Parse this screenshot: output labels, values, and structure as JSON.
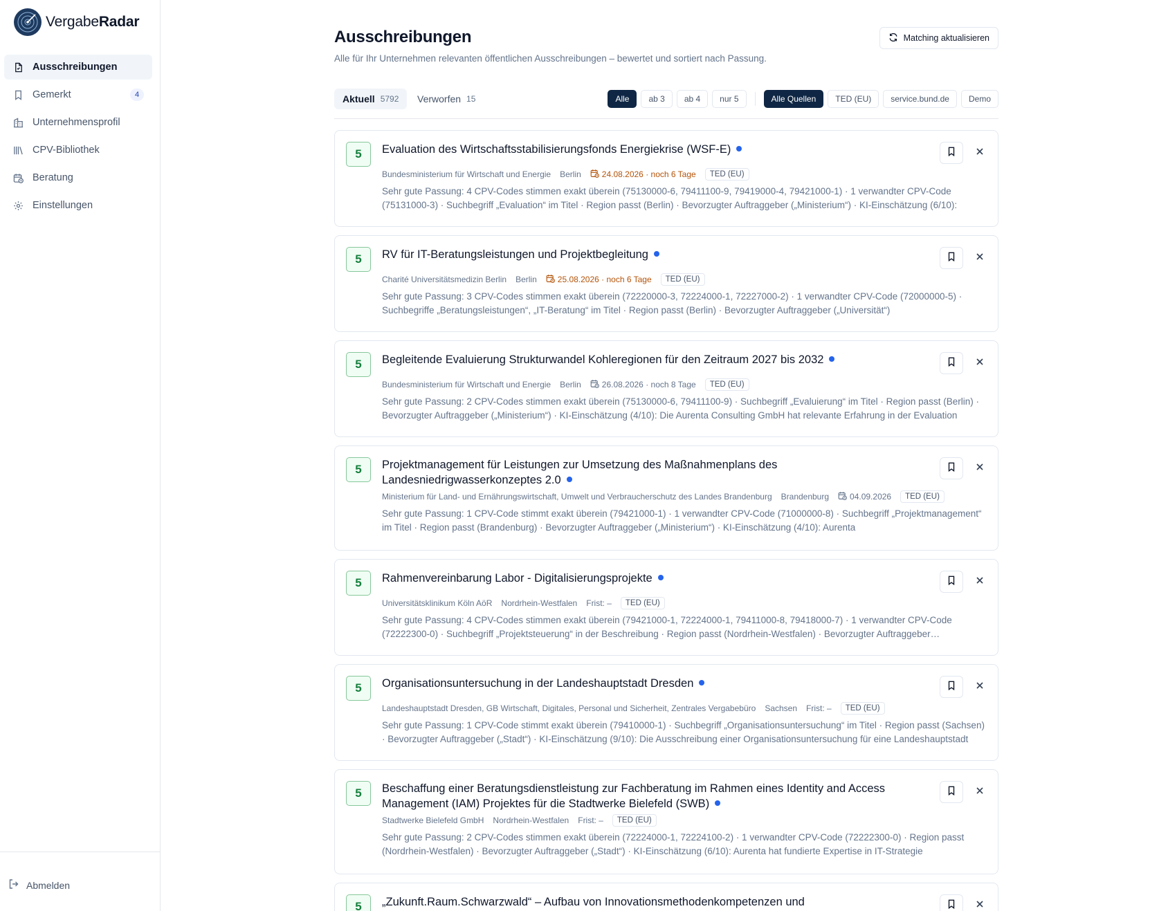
{
  "app": {
    "name_part1": "Vergabe",
    "name_part2": "Radar"
  },
  "sidebar": {
    "items": [
      {
        "label": "Ausschreibungen",
        "icon": "document-icon",
        "active": true
      },
      {
        "label": "Gemerkt",
        "icon": "bookmark-icon",
        "badge": "4"
      },
      {
        "label": "Unternehmensprofil",
        "icon": "building-icon"
      },
      {
        "label": "CPV-Bibliothek",
        "icon": "library-icon"
      },
      {
        "label": "Beratung",
        "icon": "calendar-clock-icon"
      },
      {
        "label": "Einstellungen",
        "icon": "gear-icon"
      }
    ],
    "logout": "Abmelden"
  },
  "header": {
    "title": "Ausschreibungen",
    "subtitle": "Alle für Ihr Unternehmen relevanten öffentlichen Ausschreibungen – bewertet und sortiert nach Passung.",
    "refresh_label": "Matching aktualisieren"
  },
  "tabs": [
    {
      "label": "Aktuell",
      "count": "5792"
    },
    {
      "label": "Verworfen",
      "count": "15"
    }
  ],
  "score_filters": [
    "Alle",
    "ab 3",
    "ab 4",
    "nur 5"
  ],
  "source_filters": [
    "Alle Quellen",
    "TED (EU)",
    "service.bund.de",
    "Demo"
  ],
  "colors": {
    "accent": "#0f2744",
    "score_green": "#15803d",
    "unread_dot": "#2563eb",
    "deadline_warn": "#b45309"
  },
  "tenders": [
    {
      "score": "5",
      "title": "Evaluation des Wirtschaftsstabilisierungsfonds Energiekrise (WSF-E)",
      "authority": "Bundesministerium für Wirtschaft und Energie",
      "region": "Berlin",
      "deadline": "24.08.2026 · noch 6 Tage",
      "deadline_warn": true,
      "source": "TED (EU)",
      "description": "Sehr gute Passung: 4 CPV-Codes stimmen exakt überein (75130000-6, 79411100-9, 79419000-4, 79421000-1) · 1 verwandter CPV-Code (75131000-3) · Suchbegriff „Evaluation“ im Titel · Region passt (Berlin) · Bevorzugter Auftraggeber („Ministerium“) · KI-Einschätzung (6/10):"
    },
    {
      "score": "5",
      "title": "RV für IT-Beratungsleistungen und Projektbegleitung",
      "authority": "Charité Universitätsmedizin Berlin",
      "region": "Berlin",
      "deadline": "25.08.2026 · noch 6 Tage",
      "deadline_warn": true,
      "source": "TED (EU)",
      "description": "Sehr gute Passung: 3 CPV-Codes stimmen exakt überein (72220000-3, 72224000-1, 72227000-2) · 1 verwandter CPV-Code (72000000-5) · Suchbegriffe „Beratungsleistungen“, „IT-Beratung“ im Titel · Region passt (Berlin) · Bevorzugter Auftraggeber („Universität“)"
    },
    {
      "score": "5",
      "title": "Begleitende Evaluierung Strukturwandel Kohleregionen für den Zeitraum 2027 bis 2032",
      "authority": "Bundesministerium für Wirtschaft und Energie",
      "region": "Berlin",
      "deadline": "26.08.2026 · noch 8 Tage",
      "deadline_warn": false,
      "source": "TED (EU)",
      "description": "Sehr gute Passung: 2 CPV-Codes stimmen exakt überein (75130000-6, 79411100-9) · Suchbegriff „Evaluierung“ im Titel · Region passt (Berlin) · Bevorzugter Auftraggeber („Ministerium“) · KI-Einschätzung (4/10): Die Aurenta Consulting GmbH hat relevante Erfahrung in der Evaluation"
    },
    {
      "score": "5",
      "title": "Projektmanagement für Leistungen zur Umsetzung des Maßnahmenplans des Landesniedrigwasserkonzeptes 2.0",
      "authority": "Ministerium für Land- und Ernährungswirtschaft, Umwelt und Verbraucherschutz des Landes Brandenburg",
      "region": "Brandenburg",
      "deadline": "04.09.2026",
      "deadline_warn": false,
      "source": "TED (EU)",
      "description": "Sehr gute Passung: 1 CPV-Code stimmt exakt überein (79421000-1) · 1 verwandter CPV-Code (71000000-8) · Suchbegriff „Projektmanagement“ im Titel · Region passt (Brandenburg) · Bevorzugter Auftraggeber („Ministerium“) · KI-Einschätzung (4/10): Aurenta"
    },
    {
      "score": "5",
      "title": "Rahmenvereinbarung Labor - Digitalisierungsprojekte",
      "authority": "Universitätsklinikum Köln AöR",
      "region": "Nordrhein-Westfalen",
      "deadline": "Frist: –",
      "deadline_warn": false,
      "source": "TED (EU)",
      "description": "Sehr gute Passung: 4 CPV-Codes stimmen exakt überein (79421000-1, 72224000-1, 79411000-8, 79418000-7) · 1 verwandter CPV-Code (72222300-0) · Suchbegriff „Projektsteuerung“ in der Beschreibung · Region passt (Nordrhein-Westfalen) · Bevorzugter Auftraggeber („Universität“)"
    },
    {
      "score": "5",
      "title": "Organisationsuntersuchung in der Landeshauptstadt Dresden",
      "authority": "Landeshauptstadt Dresden, GB Wirtschaft, Digitales, Personal und Sicherheit, Zentrales Vergabebüro",
      "region": "Sachsen",
      "deadline": "Frist: –",
      "deadline_warn": false,
      "source": "TED (EU)",
      "description": "Sehr gute Passung: 1 CPV-Code stimmt exakt überein (79410000-1) · Suchbegriff „Organisationsuntersuchung“ im Titel · Region passt (Sachsen) · Bevorzugter Auftraggeber („Stadt“) · KI-Einschätzung (9/10): Die Ausschreibung einer Organisationsuntersuchung für eine Landeshauptstadt"
    },
    {
      "score": "5",
      "title": "Beschaffung einer Beratungsdienstleistung zur Fachberatung im Rahmen eines Identity and Access Management (IAM) Projektes für die Stadtwerke Bielefeld (SWB)",
      "authority": "Stadtwerke Bielefeld GmbH",
      "region": "Nordrhein-Westfalen",
      "deadline": "Frist: –",
      "deadline_warn": false,
      "source": "TED (EU)",
      "description": "Sehr gute Passung: 2 CPV-Codes stimmen exakt überein (72224000-1, 72224100-2) · 1 verwandter CPV-Code (72222300-0) · Region passt (Nordrhein-Westfalen) · Bevorzugter Auftraggeber („Stadt“) · KI-Einschätzung (6/10): Aurenta hat fundierte Expertise in IT-Strategie"
    },
    {
      "score": "5",
      "title": "„Zukunft.Raum.Schwarzwald“ – Aufbau von Innovationsmethodenkompetenzen und",
      "authority": "",
      "region": "",
      "deadline": "",
      "deadline_warn": false,
      "source": "",
      "description": ""
    }
  ]
}
